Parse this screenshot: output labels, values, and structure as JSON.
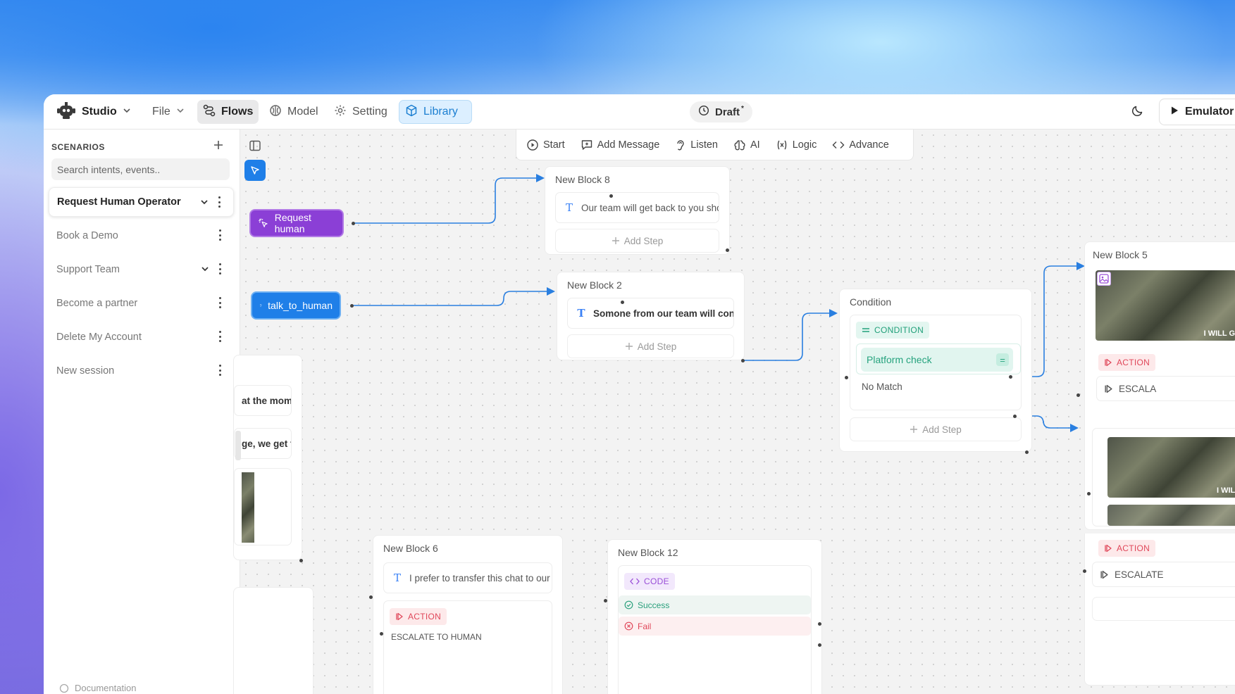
{
  "topbar": {
    "app_name": "Studio",
    "file": "File",
    "flows": "Flows",
    "model": "Model",
    "setting": "Setting",
    "library": "Library",
    "draft": "Draft",
    "draft_mark": "*",
    "emulator": "Emulator"
  },
  "sidebar": {
    "heading": "SCENARIOS",
    "search_placeholder": "Search intents, events..",
    "items": [
      {
        "label": "Request Human Operator",
        "active": true,
        "expandable": true
      },
      {
        "label": "Book a Demo"
      },
      {
        "label": "Support Team",
        "expandable": true
      },
      {
        "label": "Become a partner"
      },
      {
        "label": "Delete My Account"
      },
      {
        "label": "New session"
      }
    ],
    "footer": "Documentation"
  },
  "toolbar": {
    "start": "Start",
    "add_message": "Add Message",
    "listen": "Listen",
    "ai": "AI",
    "logic": "Logic",
    "advance": "Advance"
  },
  "triggers": {
    "request_human": "Request human",
    "talk_to_human": "talk_to_human"
  },
  "blocks": {
    "block8": {
      "title": "New Block 8",
      "text": "Our team will get back to you shortly",
      "add_step": "Add Step"
    },
    "block2": {
      "title": "New Block 2",
      "text": "Somone from our team will connect",
      "add_step": "Add Step"
    },
    "condition": {
      "title": "Condition",
      "tag": "CONDITION",
      "check": "Platform check",
      "no_match": "No Match",
      "add_step": "Add Step"
    },
    "block5": {
      "title": "New Block 5",
      "action": "ACTION",
      "action_text": "ESCALA",
      "image_text": "I WILL G",
      "image_text2": "I WILL",
      "action2": "ACTION",
      "action2_text": "ESCALATE"
    },
    "block6": {
      "title": "New Block 6",
      "text": "I prefer to transfer this chat to our su",
      "action": "ACTION",
      "action_text": "ESCALATE TO HUMAN"
    },
    "block12": {
      "title": "New Block 12",
      "tag": "CODE",
      "success": "Success",
      "fail": "Fail"
    },
    "partial_left": {
      "text1": "at the mom",
      "text2": "ge, we get t"
    }
  }
}
